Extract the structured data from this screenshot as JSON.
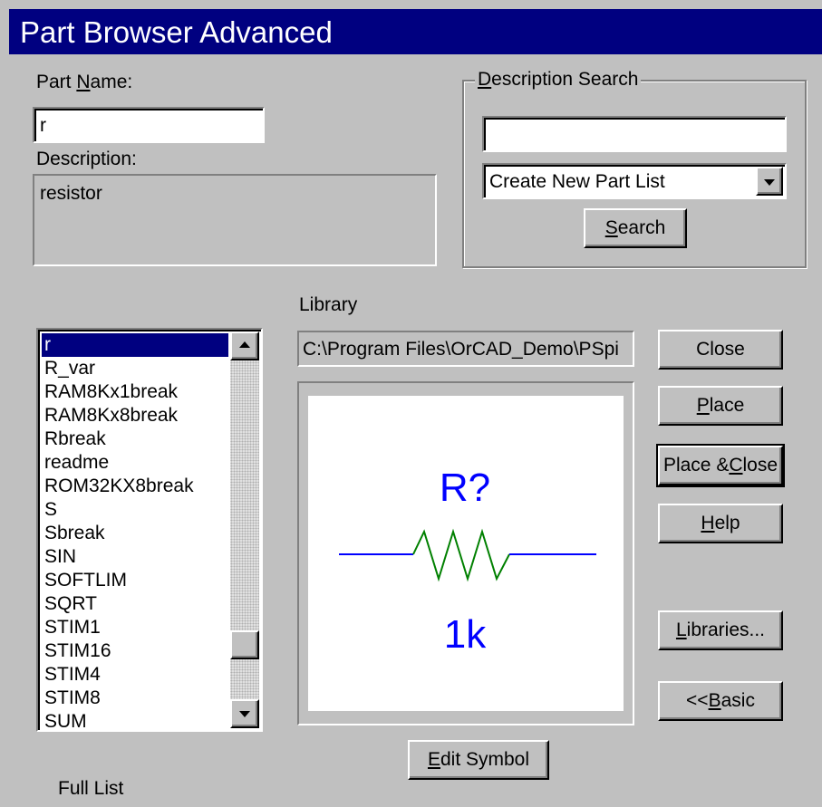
{
  "window": {
    "title": "Part Browser Advanced"
  },
  "part_name": {
    "label_pre": "Part ",
    "label_u": "N",
    "label_post": "ame:",
    "value": "r"
  },
  "description": {
    "label": "Description:",
    "value": "resistor"
  },
  "description_search": {
    "legend_u": "D",
    "legend_post": "escription Search",
    "value": "",
    "dropdown_selected": "Create New Part List",
    "search_u": "S",
    "search_post": "earch"
  },
  "library": {
    "label": "Library",
    "path": "C:\\Program Files\\OrCAD_Demo\\PSpi"
  },
  "parts": [
    "r",
    "R_var",
    "RAM8Kx1break",
    "RAM8Kx8break",
    "Rbreak",
    "readme",
    "ROM32KX8break",
    "S",
    "Sbreak",
    "SIN",
    "SOFTLIM",
    "SQRT",
    "STIM1",
    "STIM16",
    "STIM4",
    "STIM8",
    "SUM"
  ],
  "selected_part": "r",
  "list_footer": "Full List",
  "preview": {
    "ref": "R?",
    "value": "1k",
    "wire_color": "#0000ff",
    "body_color": "#008000",
    "text_color": "#0000ff"
  },
  "buttons": {
    "close": "Close",
    "place_u": "P",
    "place_post": "lace",
    "place_close_pre": "Place & ",
    "place_close_u": "C",
    "place_close_post": "lose",
    "help_u": "H",
    "help_post": "elp",
    "libraries_u": "L",
    "libraries_post": "ibraries...",
    "basic_pre": "<< ",
    "basic_u": "B",
    "basic_post": "asic",
    "edit_u": "E",
    "edit_post": "dit Symbol"
  },
  "colors": {
    "title_bg": "#000080",
    "face": "#c0c0c0",
    "selection": "#000080"
  }
}
